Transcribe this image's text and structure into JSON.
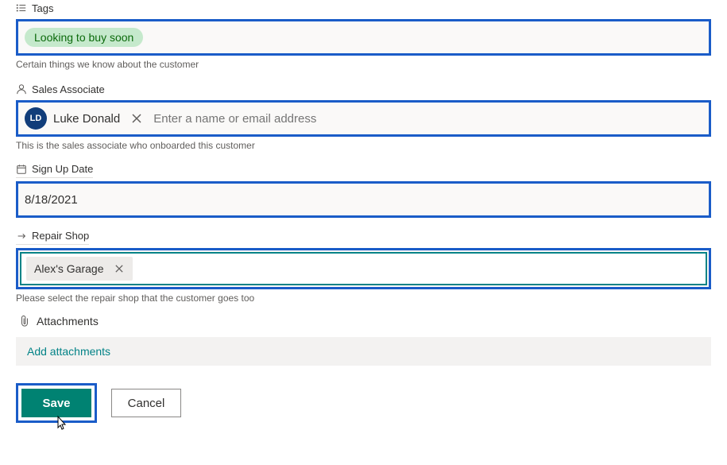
{
  "tags": {
    "label": "Tags",
    "items": [
      "Looking to buy soon"
    ],
    "description": "Certain things we know about the customer"
  },
  "salesAssociate": {
    "label": "Sales Associate",
    "person": {
      "initials": "LD",
      "name": "Luke Donald"
    },
    "placeholder": "Enter a name or email address",
    "description": "This is the sales associate who onboarded this customer"
  },
  "signUpDate": {
    "label": "Sign Up Date",
    "value": "8/18/2021"
  },
  "repairShop": {
    "label": "Repair Shop",
    "selected": "Alex's Garage",
    "description": "Please select the repair shop that the customer goes too"
  },
  "attachments": {
    "label": "Attachments",
    "addLabel": "Add attachments"
  },
  "buttons": {
    "save": "Save",
    "cancel": "Cancel"
  }
}
